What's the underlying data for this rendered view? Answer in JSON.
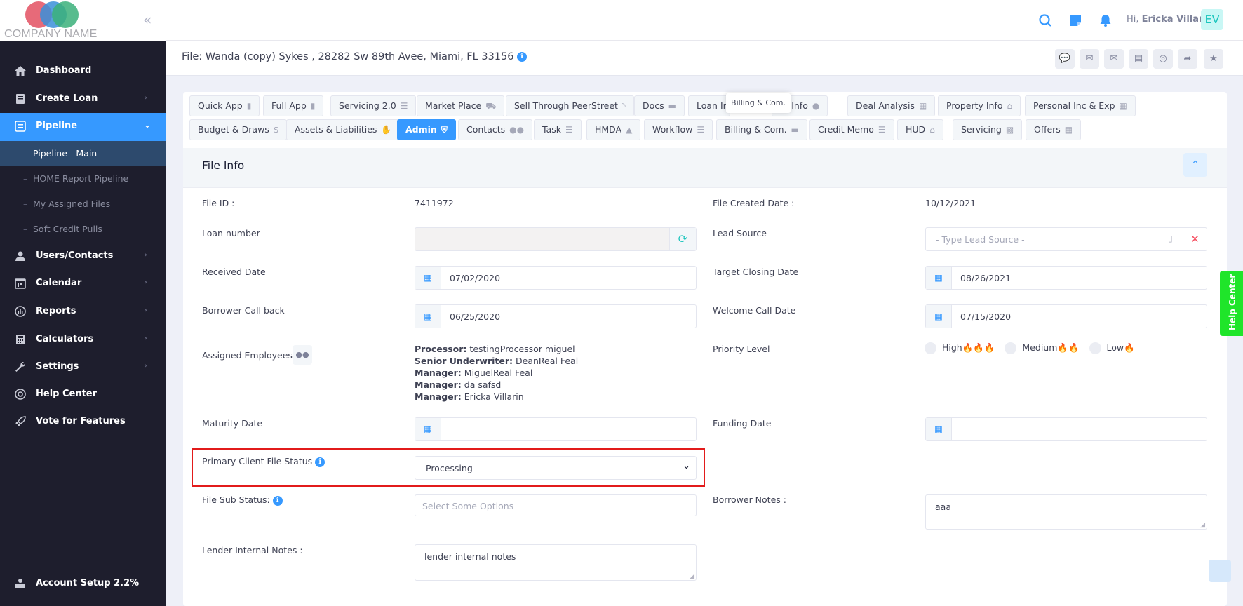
{
  "brand": {
    "company_name": "COMPANY NAME",
    "collapse_icon": "double-chevron-left-icon"
  },
  "topbar": {
    "greeting_prefix": "Hi,",
    "user_name": "Ericka Villarin",
    "avatar_initials": "EV",
    "icons": [
      "search-icon",
      "notes-icon",
      "bell-icon"
    ]
  },
  "sidebar": {
    "items": [
      {
        "label": "Dashboard",
        "icon": "home-icon"
      },
      {
        "label": "Create Loan",
        "icon": "file-icon"
      },
      {
        "label": "Pipeline",
        "icon": "list-icon"
      },
      {
        "label": "Users/Contacts",
        "icon": "user-icon"
      },
      {
        "label": "Calendar",
        "icon": "calendar-icon"
      },
      {
        "label": "Reports",
        "icon": "chart-icon"
      },
      {
        "label": "Calculators",
        "icon": "calculator-icon"
      },
      {
        "label": "Settings",
        "icon": "wrench-icon"
      },
      {
        "label": "Help Center",
        "icon": "lifebuoy-icon"
      },
      {
        "label": "Vote for Features",
        "icon": "rocket-icon"
      }
    ],
    "pipeline_sub": [
      "Pipeline - Main",
      "HOME Report Pipeline",
      "My Assigned Files",
      "Soft Credit Pulls"
    ],
    "account_setup": "Account Setup 2.2%"
  },
  "subheader": {
    "title": "File: Wanda (copy) Sykes , 28282 Sw 89th Avee, Miami, FL 33156"
  },
  "tabs_row1": [
    "Quick App",
    "Full App",
    "Servicing 2.0",
    "Market Place",
    "Sell Through PeerStreet",
    "Docs",
    "Loan In",
    "ver Info",
    "Deal Analysis",
    "Property Info",
    "Personal Inc & Exp"
  ],
  "tabs_row2": [
    "Budget & Draws",
    "Assets & Liabilities",
    "Admin",
    "Contacts",
    "Task",
    "HMDA",
    "Workflow",
    "Billing & Com.",
    "Credit Memo",
    "HUD",
    "Servicing",
    "Offers"
  ],
  "tooltip": "Billing & Com.",
  "section": {
    "title": "File Info"
  },
  "fields": {
    "file_id_label": "File ID :",
    "file_id": "7411972",
    "created_label": "File Created Date :",
    "created": "10/12/2021",
    "loan_number_label": "Loan number",
    "loan_number": "",
    "lead_source_label": "Lead Source",
    "lead_source_placeholder": "- Type Lead Source -",
    "received_label": "Received Date",
    "received": "07/02/2020",
    "target_label": "Target Closing Date",
    "target": "08/26/2021",
    "callback_label": "Borrower Call back",
    "callback": "06/25/2020",
    "welcome_label": "Welcome Call Date",
    "welcome": "07/15/2020",
    "assigned_label": "Assigned Employees",
    "employees": [
      {
        "role": "Processor:",
        "name": "testingProcessor miguel"
      },
      {
        "role": "Senior Underwriter:",
        "name": "DeanReal Feal"
      },
      {
        "role": "Manager:",
        "name": "MiguelReal Feal"
      },
      {
        "role": "Manager:",
        "name": "da safsd"
      },
      {
        "role": "Manager:",
        "name": "Ericka Villarin"
      }
    ],
    "priority_label": "Priority Level",
    "priority_options": [
      "High",
      "Medium",
      "Low"
    ],
    "maturity_label": "Maturity Date",
    "funding_label": "Funding Date",
    "status_label": "Primary Client File Status",
    "status_value": "Processing",
    "sub_status_label": "File Sub Status:",
    "sub_status_placeholder": "Select Some Options",
    "borrower_notes_label": "Borrower Notes :",
    "borrower_notes": "aaa",
    "lender_notes_label": "Lender Internal Notes :",
    "lender_notes": "lender internal notes"
  },
  "help_center_tab": "Help Center",
  "colors": {
    "accent": "#3699ff",
    "sidebar": "#1e1e2d",
    "highlight_box": "#e21b1b",
    "help_tab": "#1fe52a"
  }
}
